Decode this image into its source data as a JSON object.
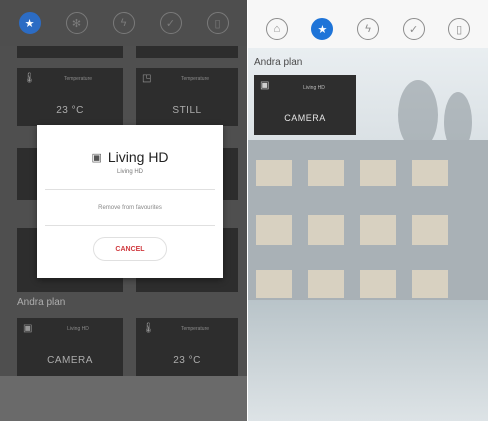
{
  "left": {
    "tabs": [
      {
        "icon": "star-icon",
        "glyph": "★",
        "active": true
      },
      {
        "icon": "fan-icon",
        "glyph": "✻",
        "active": false
      },
      {
        "icon": "bolt-icon",
        "glyph": "ϟ",
        "active": false
      },
      {
        "icon": "check-icon",
        "glyph": "✓",
        "active": false
      },
      {
        "icon": "door-icon",
        "glyph": "▯",
        "active": false
      }
    ],
    "tiles_top": [
      {
        "icon": "thermometer-icon",
        "glyph": "🌡",
        "label": "Temperature",
        "value": "23 °C"
      },
      {
        "icon": "sensor-icon",
        "glyph": "◳",
        "label": "Temperature",
        "value": "STILL"
      }
    ],
    "section_label": "Andra plan",
    "tiles_bottom": [
      {
        "icon": "camera-icon",
        "glyph": "▣",
        "label": "Living HD",
        "value": "CAMERA"
      },
      {
        "icon": "thermometer-icon",
        "glyph": "🌡",
        "label": "Temperature",
        "value": "23 °C"
      }
    ],
    "dialog": {
      "title": "Living HD",
      "subtitle": "Living HD",
      "remove_label": "Remove from favourites",
      "cancel_label": "CANCEL"
    }
  },
  "right": {
    "tabs": [
      {
        "icon": "home-icon",
        "glyph": "⌂",
        "active": false
      },
      {
        "icon": "star-icon",
        "glyph": "★",
        "active": true
      },
      {
        "icon": "bolt-icon",
        "glyph": "ϟ",
        "active": false
      },
      {
        "icon": "check-icon",
        "glyph": "✓",
        "active": false
      },
      {
        "icon": "door-icon",
        "glyph": "▯",
        "active": false
      }
    ],
    "section_label": "Andra plan",
    "tile": {
      "icon": "camera-icon",
      "glyph": "▣",
      "label": "Living HD",
      "value": "CAMERA"
    }
  },
  "colors": {
    "accent": "#1e74d8",
    "cancel": "#d0393e",
    "tile_bg": "#2f2f2f"
  }
}
